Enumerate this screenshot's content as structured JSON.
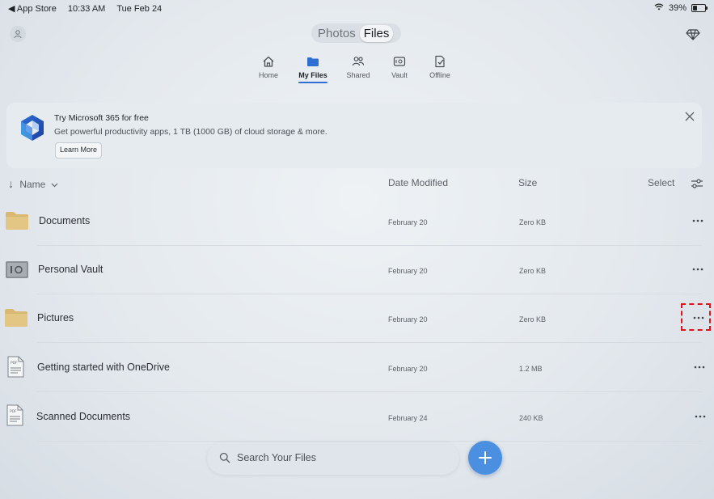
{
  "status_bar": {
    "back_app": "App Store",
    "time": "10:33 AM",
    "date": "Tue Feb 24",
    "battery": "39%",
    "battery_level": 0.39
  },
  "segmented": {
    "photos": "Photos",
    "files": "Files",
    "selected": "Files"
  },
  "nav": {
    "tabs": [
      {
        "label": "Home",
        "icon": "home-icon"
      },
      {
        "label": "My Files",
        "icon": "folder-icon",
        "active": true
      },
      {
        "label": "Shared",
        "icon": "people-icon"
      },
      {
        "label": "Vault",
        "icon": "vault-icon"
      },
      {
        "label": "Offline",
        "icon": "offline-icon"
      }
    ]
  },
  "banner": {
    "title": "Try Microsoft 365 for free",
    "description": "Get powerful productivity apps, 1 TB (1000 GB) of cloud storage & more.",
    "button": "Learn More"
  },
  "list_header": {
    "name": "Name",
    "date_modified": "Date Modified",
    "size": "Size",
    "select": "Select"
  },
  "files": [
    {
      "name": "Documents",
      "date": "February 20",
      "size": "Zero KB",
      "type": "folder"
    },
    {
      "name": "Personal Vault",
      "date": "February 20",
      "size": "Zero KB",
      "type": "vault"
    },
    {
      "name": "Pictures",
      "date": "February 20",
      "size": "Zero KB",
      "type": "folder"
    },
    {
      "name": "Getting started with OneDrive",
      "date": "February 20",
      "size": "1.2 MB",
      "type": "pdf"
    },
    {
      "name": "Scanned Documents",
      "date": "February 24",
      "size": "240 KB",
      "type": "pdf"
    }
  ],
  "search": {
    "placeholder": "Search Your Files"
  },
  "colors": {
    "accent": "#2f6fd4",
    "fab": "#4a8fe0",
    "folder": "#d9b872",
    "highlight": "#e0141c"
  }
}
